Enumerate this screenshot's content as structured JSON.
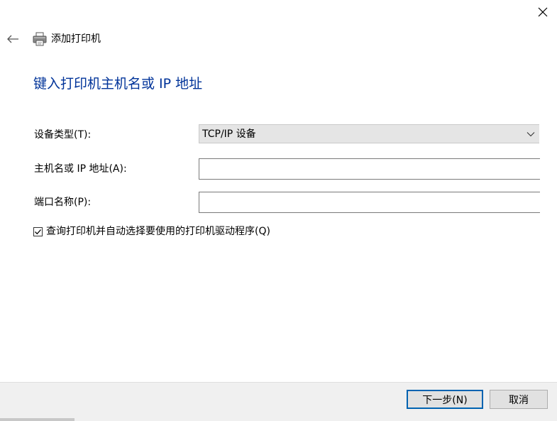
{
  "window": {
    "title": "添加打印机"
  },
  "icons": {
    "close": "close-icon",
    "back": "arrow-left-icon",
    "printer": "printer-icon",
    "chevron": "chevron-down-icon",
    "check": "checkmark-icon"
  },
  "heading": "键入打印机主机名或 IP 地址",
  "form": {
    "device_type_label": "设备类型(T):",
    "device_type_value": "TCP/IP 设备",
    "hostname_label": "主机名或 IP 地址(A):",
    "hostname_value": "",
    "port_label": "端口名称(P):",
    "port_value": "",
    "auto_select_label": "查询打印机并自动选择要使用的打印机驱动程序(Q)",
    "auto_select_checked": true
  },
  "buttons": {
    "next": "下一步(N)",
    "cancel": "取消"
  },
  "colors": {
    "heading": "#003399",
    "primary_button_border": "#0063b1",
    "footer": "#f0f0f0",
    "select_bg": "#e5e5e5"
  }
}
